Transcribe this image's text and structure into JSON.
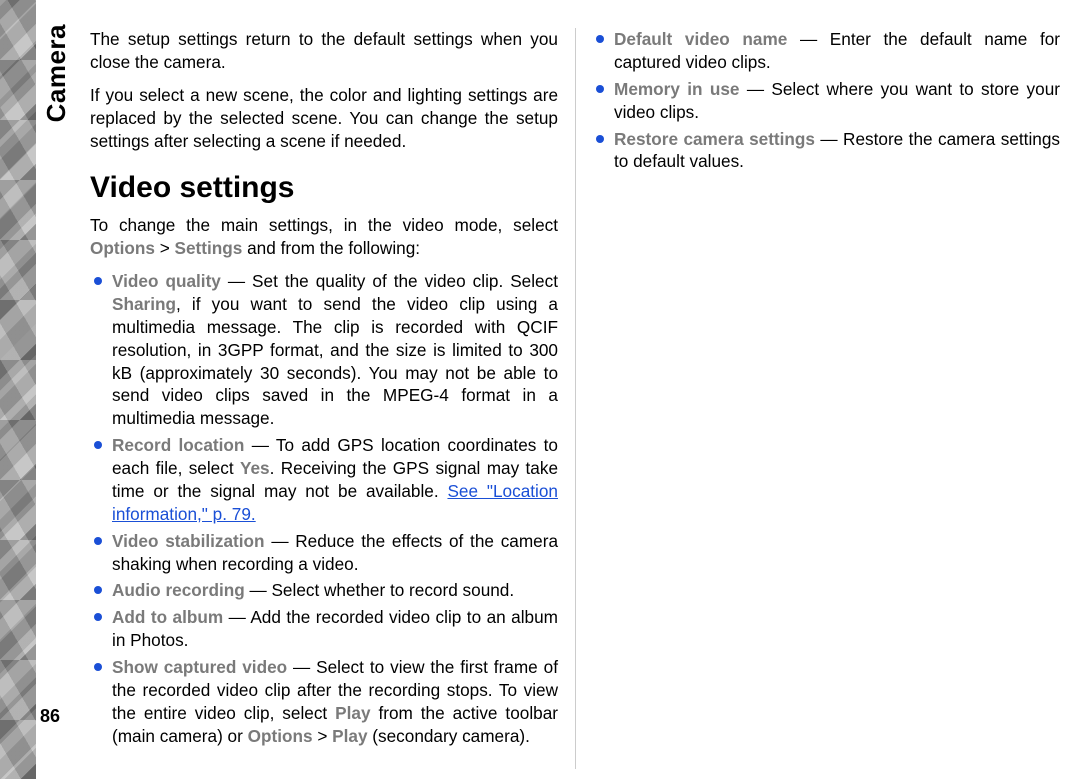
{
  "section": "Camera",
  "pageNumber": "86",
  "para1": "The setup settings return to the default settings when you close the camera.",
  "para2": "If you select a new scene, the color and lighting settings are replaced by the selected scene. You can change the setup settings after selecting a scene if needed.",
  "heading": "Video settings",
  "intro_pre": "To change the main settings, in the video mode, select ",
  "intro_opt": "Options",
  "intro_gt": " > ",
  "intro_set": "Settings",
  "intro_post": " and from the following:",
  "items": {
    "vq": {
      "term": "Video quality",
      "pre": " — Set the quality of the video clip. Select ",
      "sharing": "Sharing",
      "post": ", if you want to send the video clip using a multimedia message. The clip is recorded with QCIF resolution, in 3GPP format, and the size is limited to 300 kB (approximately 30 seconds). You may not be able to send video clips saved in the MPEG-4 format in a multimedia message."
    },
    "rl": {
      "term": "Record location",
      "pre": " — To add GPS location coordinates to each file, select ",
      "yes": "Yes",
      "mid": ". Receiving the GPS signal may take time or the signal may not be available. ",
      "link": "See \"Location information,\" p. 79."
    },
    "vs": {
      "term": "Video stabilization",
      "body": " — Reduce the effects of the camera shaking when recording a video."
    },
    "ar": {
      "term": "Audio recording",
      "body": " — Select whether to record sound."
    },
    "aa": {
      "term": "Add to album",
      "body": " — Add the recorded video clip to an album in Photos."
    },
    "scv": {
      "term": "Show captured video",
      "pre": " — Select to view the first frame of the recorded video clip after the recording stops. To view the entire video clip, select ",
      "play1": "Play",
      "mid": " from the active toolbar (main camera) or ",
      "opt": "Options",
      "gt": " > ",
      "play2": "Play",
      "post": " (secondary camera)."
    },
    "dvn": {
      "term": "Default video name",
      "body": " — Enter the default name for captured video clips."
    },
    "miu": {
      "term": "Memory in use",
      "body": " — Select where you want to store your video clips."
    },
    "rcs": {
      "term": "Restore camera settings",
      "body": " — Restore the camera settings to default values."
    }
  }
}
